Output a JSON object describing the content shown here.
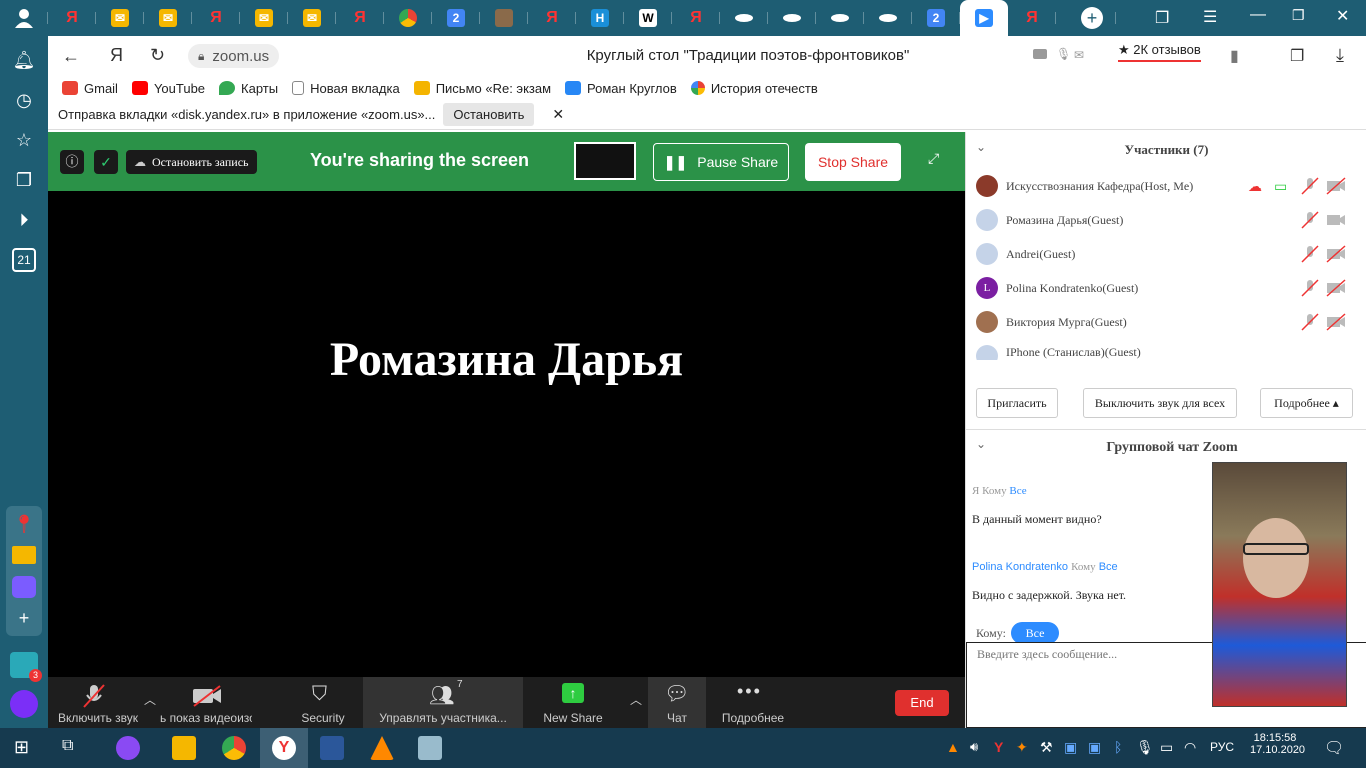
{
  "browser": {
    "address": "zoom.us",
    "page_title": "Круглый стол \"Традиции поэтов-фронтовиков\"",
    "reviews": "★ 2К отзывов",
    "yandex_letter": "Я"
  },
  "bookmarks": [
    {
      "label": "Gmail",
      "color": "#ea4335"
    },
    {
      "label": "YouTube",
      "color": "#ff0000"
    },
    {
      "label": "Карты",
      "color": "#34a853"
    },
    {
      "label": "Новая вкладка",
      "color": "#888888"
    },
    {
      "label": "Письмо «Re: экзам",
      "color": "#f4b400"
    },
    {
      "label": "Роман Круглов",
      "color": "#2787f5"
    },
    {
      "label": "История отечеств",
      "color": "#e94235"
    }
  ],
  "notice": {
    "text": "Отправка вкладки «disk.yandex.ru» в приложение «zoom.us»...",
    "stop_label": "Остановить",
    "close": "✕"
  },
  "sharebar": {
    "record_label": "Остановить запись",
    "sharing_text": "You're sharing the screen",
    "pause_label": "Pause Share",
    "stop_label": "Stop Share"
  },
  "main": {
    "speaker_name": "Ромазина Дарья"
  },
  "toolbar": {
    "mute_label": "Включить звук",
    "video_label": "ь показ видеоизо",
    "security_label": "Security",
    "participants_label": "Управлять участника...",
    "participants_count": "7",
    "new_share_label": "New Share",
    "chat_label": "Чат",
    "more_label": "Подробнее",
    "end_label": "End"
  },
  "participants": {
    "title": "Участники (7)",
    "list": [
      {
        "name": "Искусствознания Кафедра(Host, Me)",
        "avatar_color": "#8b3a2a",
        "initial": ""
      },
      {
        "name": "Ромазина Дарья(Guest)",
        "avatar_color": "#c5d3e8",
        "initial": ""
      },
      {
        "name": "Andrei(Guest)",
        "avatar_color": "#c5d3e8",
        "initial": ""
      },
      {
        "name": "Polina Kondratenko(Guest)",
        "avatar_color": "#7b1fa2",
        "initial": "L"
      },
      {
        "name": "Виктория Мурга(Guest)",
        "avatar_color": "#a07050",
        "initial": ""
      },
      {
        "name": "IPhone (Станислав)(Guest)",
        "avatar_color": "#c5d3e8",
        "initial": ""
      }
    ],
    "invite_label": "Пригласить",
    "mute_all_label": "Выключить звук для всех",
    "more_label": "Подробнее ▴"
  },
  "chat": {
    "title": "Групповой чат Zoom",
    "messages": [
      {
        "sender": "Я",
        "to_word": "Кому",
        "to": "Все",
        "text": "В данный момент видно?"
      },
      {
        "sender": "Polina Kondratenko",
        "to_word": "Кому",
        "to": "Все",
        "text": "Видно с задержкой. Звука нет."
      }
    ],
    "to_label": "Кому:",
    "to_value": "Все",
    "placeholder": "Введите здесь сообщение..."
  },
  "taskbar": {
    "lang": "РУС",
    "time": "18:15:58",
    "date": "17.10.2020"
  },
  "leftbar": {
    "calendar_day": "21",
    "badge": "3"
  }
}
